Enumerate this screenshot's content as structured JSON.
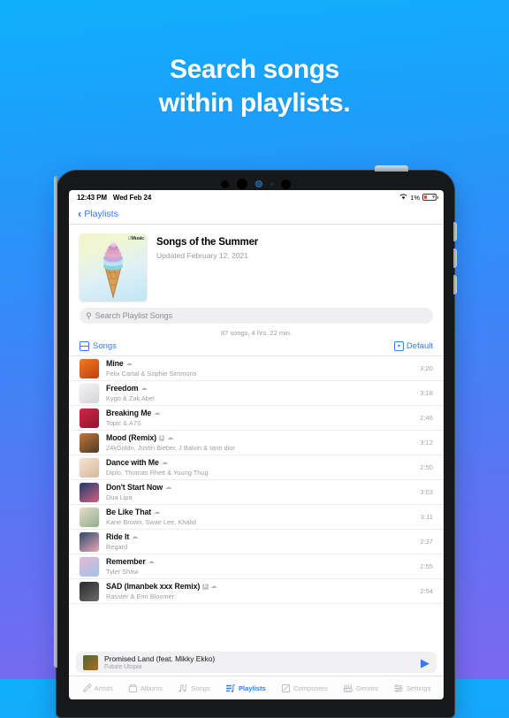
{
  "headline": {
    "line1": "Search songs",
    "line2": "within playlists."
  },
  "colors": {
    "accent": "#2f7cf6",
    "bg_top": "#0fb0fb",
    "bg_bottom": "#7c68f0",
    "muted": "#a0a0a5"
  },
  "status_bar": {
    "time": "12:43 PM",
    "date": "Wed Feb 24",
    "wifi_icon": "wifi-icon",
    "battery_percent": "1%",
    "charging_icon": "bolt-icon"
  },
  "nav": {
    "back_label": "Playlists",
    "back_icon": "chevron-left-icon"
  },
  "playlist": {
    "title": "Songs of the Summer",
    "updated": "Updated February 12, 2021",
    "apple_music_badge": "Music",
    "artwork_icon": "ice-cream-cone-artwork"
  },
  "search": {
    "placeholder": "Search Playlist Songs",
    "icon": "search-icon"
  },
  "summary": "87 songs, 4 hrs. 22 min.",
  "section": {
    "label": "Songs",
    "label_icon": "list-view-icon",
    "sort_label": "Default",
    "sort_icon": "sort-down-icon"
  },
  "songs": [
    {
      "title": "Mine",
      "artist": "Felix Cartal & Sophie Simmons",
      "duration": "3:20",
      "explicit": false,
      "cloud": true,
      "art_from": "#f07a1e",
      "art_to": "#c4400f"
    },
    {
      "title": "Freedom",
      "artist": "Kygo & Zak Abel",
      "duration": "3:18",
      "explicit": false,
      "cloud": true,
      "art_from": "#f2f2f4",
      "art_to": "#d6d6da"
    },
    {
      "title": "Breaking Me",
      "artist": "Topic & A7S",
      "duration": "2:46",
      "explicit": false,
      "cloud": true,
      "art_from": "#cf2744",
      "art_to": "#8e1430"
    },
    {
      "title": "Mood (Remix)",
      "artist": "24kGoldn, Justin Bieber, J Balvin & Iann dior",
      "duration": "3:12",
      "explicit": true,
      "cloud": true,
      "art_from": "#c2763b",
      "art_to": "#4e3b22"
    },
    {
      "title": "Dance with Me",
      "artist": "Diplo, Thomas Rhett & Young Thug",
      "duration": "2:50",
      "explicit": false,
      "cloud": true,
      "art_from": "#f5e4d4",
      "art_to": "#d8b79a"
    },
    {
      "title": "Don't Start Now",
      "artist": "Dua Lipa",
      "duration": "3:03",
      "explicit": false,
      "cloud": true,
      "art_from": "#1f3a6e",
      "art_to": "#d4607f"
    },
    {
      "title": "Be Like That",
      "artist": "Kane Brown, Swae Lee, Khalid",
      "duration": "3:11",
      "explicit": false,
      "cloud": true,
      "art_from": "#e8dcc8",
      "art_to": "#8fae8c"
    },
    {
      "title": "Ride It",
      "artist": "Regard",
      "duration": "2:37",
      "explicit": false,
      "cloud": true,
      "art_from": "#2e4a6b",
      "art_to": "#e9a6b6"
    },
    {
      "title": "Remember",
      "artist": "Tyler Shaw",
      "duration": "2:55",
      "explicit": false,
      "cloud": true,
      "art_from": "#e7b9d6",
      "art_to": "#9fc3e8"
    },
    {
      "title": "SAD (Imanbek xxx Remix)",
      "artist": "Rasster & Erin Bloomer",
      "duration": "2:54",
      "explicit": true,
      "cloud": true,
      "art_from": "#2a2a2a",
      "art_to": "#6b6b6b"
    }
  ],
  "now_playing": {
    "title": "Promised Land (feat. Mikky Ekko)",
    "artist": "Future Utopia",
    "play_icon": "play-icon",
    "art_from": "#4a6a2a",
    "art_to": "#b06a22"
  },
  "tabs": [
    {
      "label": "Artists",
      "icon": "microphone-icon",
      "active": false
    },
    {
      "label": "Albums",
      "icon": "album-icon",
      "active": false
    },
    {
      "label": "Songs",
      "icon": "music-note-icon",
      "active": false
    },
    {
      "label": "Playlists",
      "icon": "playlist-icon",
      "active": true
    },
    {
      "label": "Composers",
      "icon": "pencil-square-icon",
      "active": false
    },
    {
      "label": "Genres",
      "icon": "genres-icon",
      "active": false
    },
    {
      "label": "Settings",
      "icon": "sliders-icon",
      "active": false
    }
  ]
}
